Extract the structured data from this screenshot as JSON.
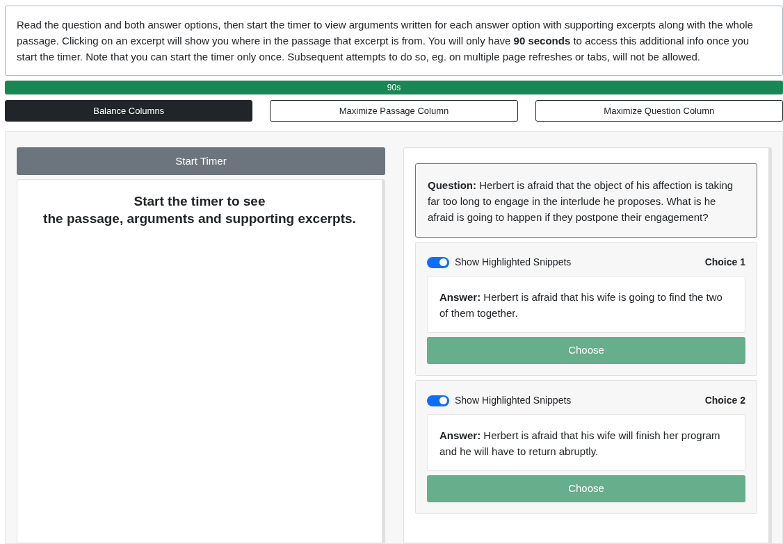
{
  "instructions": "Read the question and both answer options, then start the timer to view arguments written for each answer option with supporting excerpts along with the whole passage. Clicking on an excerpt will show you where in the passage that excerpt is from. You will only have **90 seconds** to access this additional info once you start the timer. Note that you can start the timer only once. Subsequent attempts to do so, eg. on multiple page refreshes or tabs, will not be allowed.",
  "timer_bar": {
    "label": "90s",
    "level": 1
  },
  "layout_buttons": [
    {
      "label": "Balance Columns",
      "selected": true
    },
    {
      "label": "Maximize Passage Column",
      "selected": false
    },
    {
      "label": "Maximize Question Column",
      "selected": false
    }
  ],
  "passage_column": {
    "start_button": "Start Timer",
    "message_lines": [
      "Start the timer to see",
      "the passage, arguments and supporting excerpts."
    ]
  },
  "question": "**Question:** Herbert is afraid that the object of his affection is taking far too long to engage in the interlude he proposes. What is he afraid is going to happen if they postpone their engagement?",
  "choices": [
    {
      "toggle_label": "Show Highlighted Snippets",
      "toggle_on": true,
      "title": "Choice 1",
      "answer": "**Answer:** Herbert is afraid that his wife is going to find the two of them together.",
      "button": "Choose",
      "disabled": true
    },
    {
      "toggle_label": "Show Highlighted Snippets",
      "toggle_on": true,
      "title": "Choice 2",
      "answer": "**Answer:** Herbert is afraid that his wife will finish her program and he will have to return abruptly.",
      "button": "Choose",
      "disabled": true
    }
  ]
}
